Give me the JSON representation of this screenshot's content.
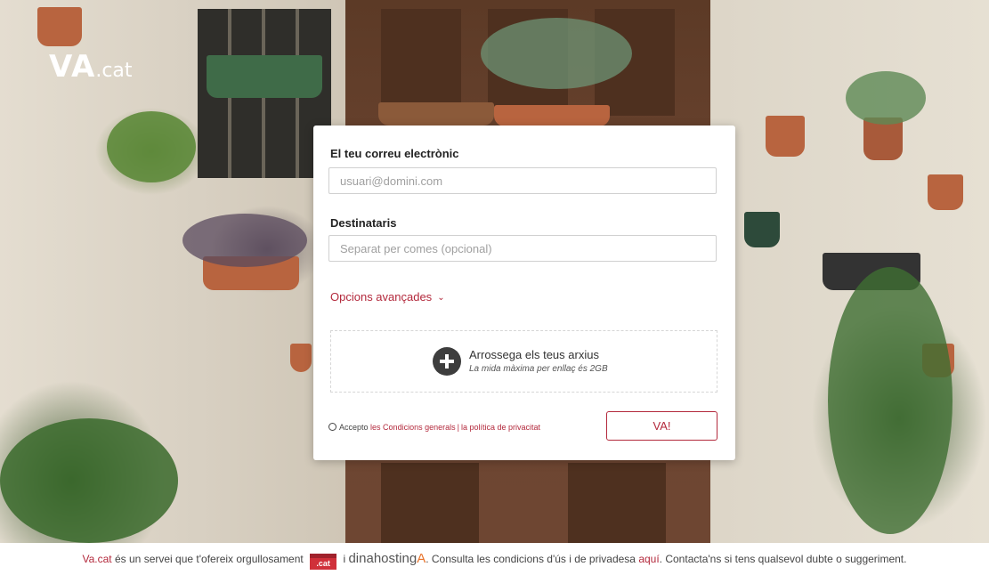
{
  "brand": {
    "logo_main": "VA",
    "logo_suffix": ".cat"
  },
  "form": {
    "email_label": "El teu correu electrònic",
    "email_placeholder": "usuari@domini.com",
    "recipients_label": "Destinataris",
    "recipients_placeholder": "Separat per comes (opcional)",
    "advanced_label": "Opcions avançades",
    "drop_title": "Arrossega els teus arxius",
    "drop_subtitle": "La mida màxima per enllaç és 2GB",
    "accept_text": "Accepto",
    "terms_link": "les Condicions generals",
    "separator": "|",
    "privacy_link": "la política de privacitat",
    "submit_label": "VA!"
  },
  "footer": {
    "site_link": "Va.cat",
    "text_1": "és un servei que t'ofereix orgullosament",
    "badge_text": ".cat",
    "text_2": "i",
    "partner": "dinahosting",
    "partner_mark": "A",
    "text_3": ". Consulta les condicions d'ús i de privadesa",
    "here_link": "aquí",
    "text_4": ". Contacta'ns si tens qualsevol dubte o suggeriment."
  },
  "colors": {
    "accent": "#b3293c",
    "door": "#6b4430",
    "wall": "#d8d0c2"
  },
  "icons": {
    "drop": "plus-circle-icon",
    "advanced": "chevron-down-icon",
    "accept": "radio-icon"
  }
}
